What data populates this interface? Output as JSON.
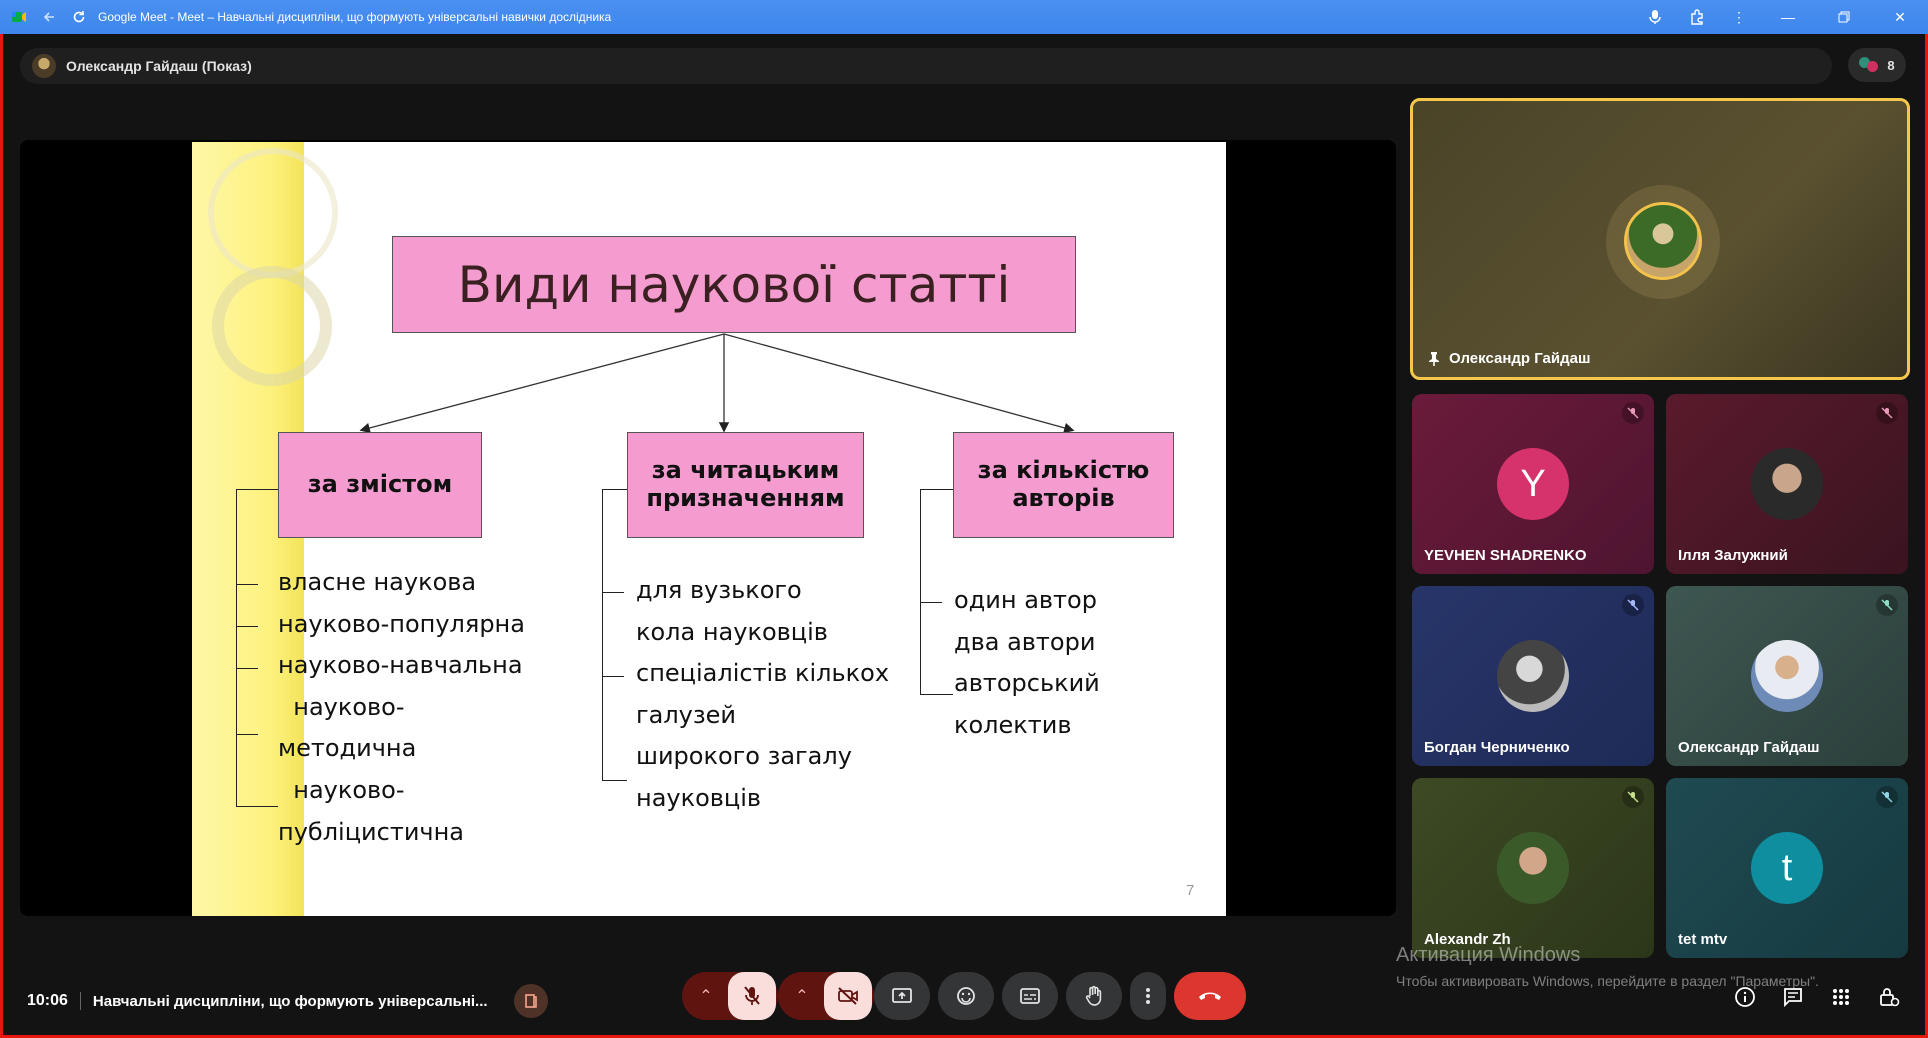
{
  "browser": {
    "title": "Google Meet - Meet – Навчальні дисципліни, що формують універсальні навички дослідника"
  },
  "presenter_bar": {
    "name": "Олександр Гайдаш (Показ)",
    "participants_count": "8"
  },
  "slide": {
    "title": "Види наукової статті",
    "number": "7",
    "categories": [
      {
        "label": "за змістом",
        "items": [
          "власне наукова",
          "науково-популярна",
          "науково-навчальна",
          "  науково-",
          "методична",
          "  науково-",
          "публіцистична"
        ]
      },
      {
        "label": "за читацьким призначенням",
        "items": [
          "для вузького",
          "кола науковців",
          "спеціалістів кількох",
          "галузей",
          "широкого загалу",
          "науковців"
        ]
      },
      {
        "label": "за кількістю авторів",
        "items": [
          "один автор",
          "два автори",
          "авторський",
          "колектив"
        ]
      }
    ]
  },
  "tiles": {
    "pinned": {
      "name": "Олександр Гайдаш"
    },
    "grid": [
      {
        "name": "YEVHEN SHADRENKO",
        "letter": "Y",
        "mic": "muted"
      },
      {
        "name": "Ілля Залужний",
        "mic": "muted"
      },
      {
        "name": "Богдан Черниченко",
        "mic": "muted"
      },
      {
        "name": "Олександр Гайдаш",
        "mic": "muted"
      },
      {
        "name": "Alexandr Zh",
        "mic": "muted"
      },
      {
        "name": "tet mtv",
        "letter": "t",
        "mic": "muted"
      }
    ]
  },
  "bottom": {
    "time": "10:06",
    "meeting_title": "Навчальні дисципліни, що формують універсальні..."
  },
  "watermark": {
    "line1": "Активация Windows",
    "line2": "Чтобы активировать Windows, перейдите в раздел \"Параметры\"."
  },
  "colors": {
    "accent_pin": "#f5c84c",
    "hangup": "#dc362e",
    "slide_box": "#f49cd0",
    "titlebar": "#3f86ee"
  }
}
